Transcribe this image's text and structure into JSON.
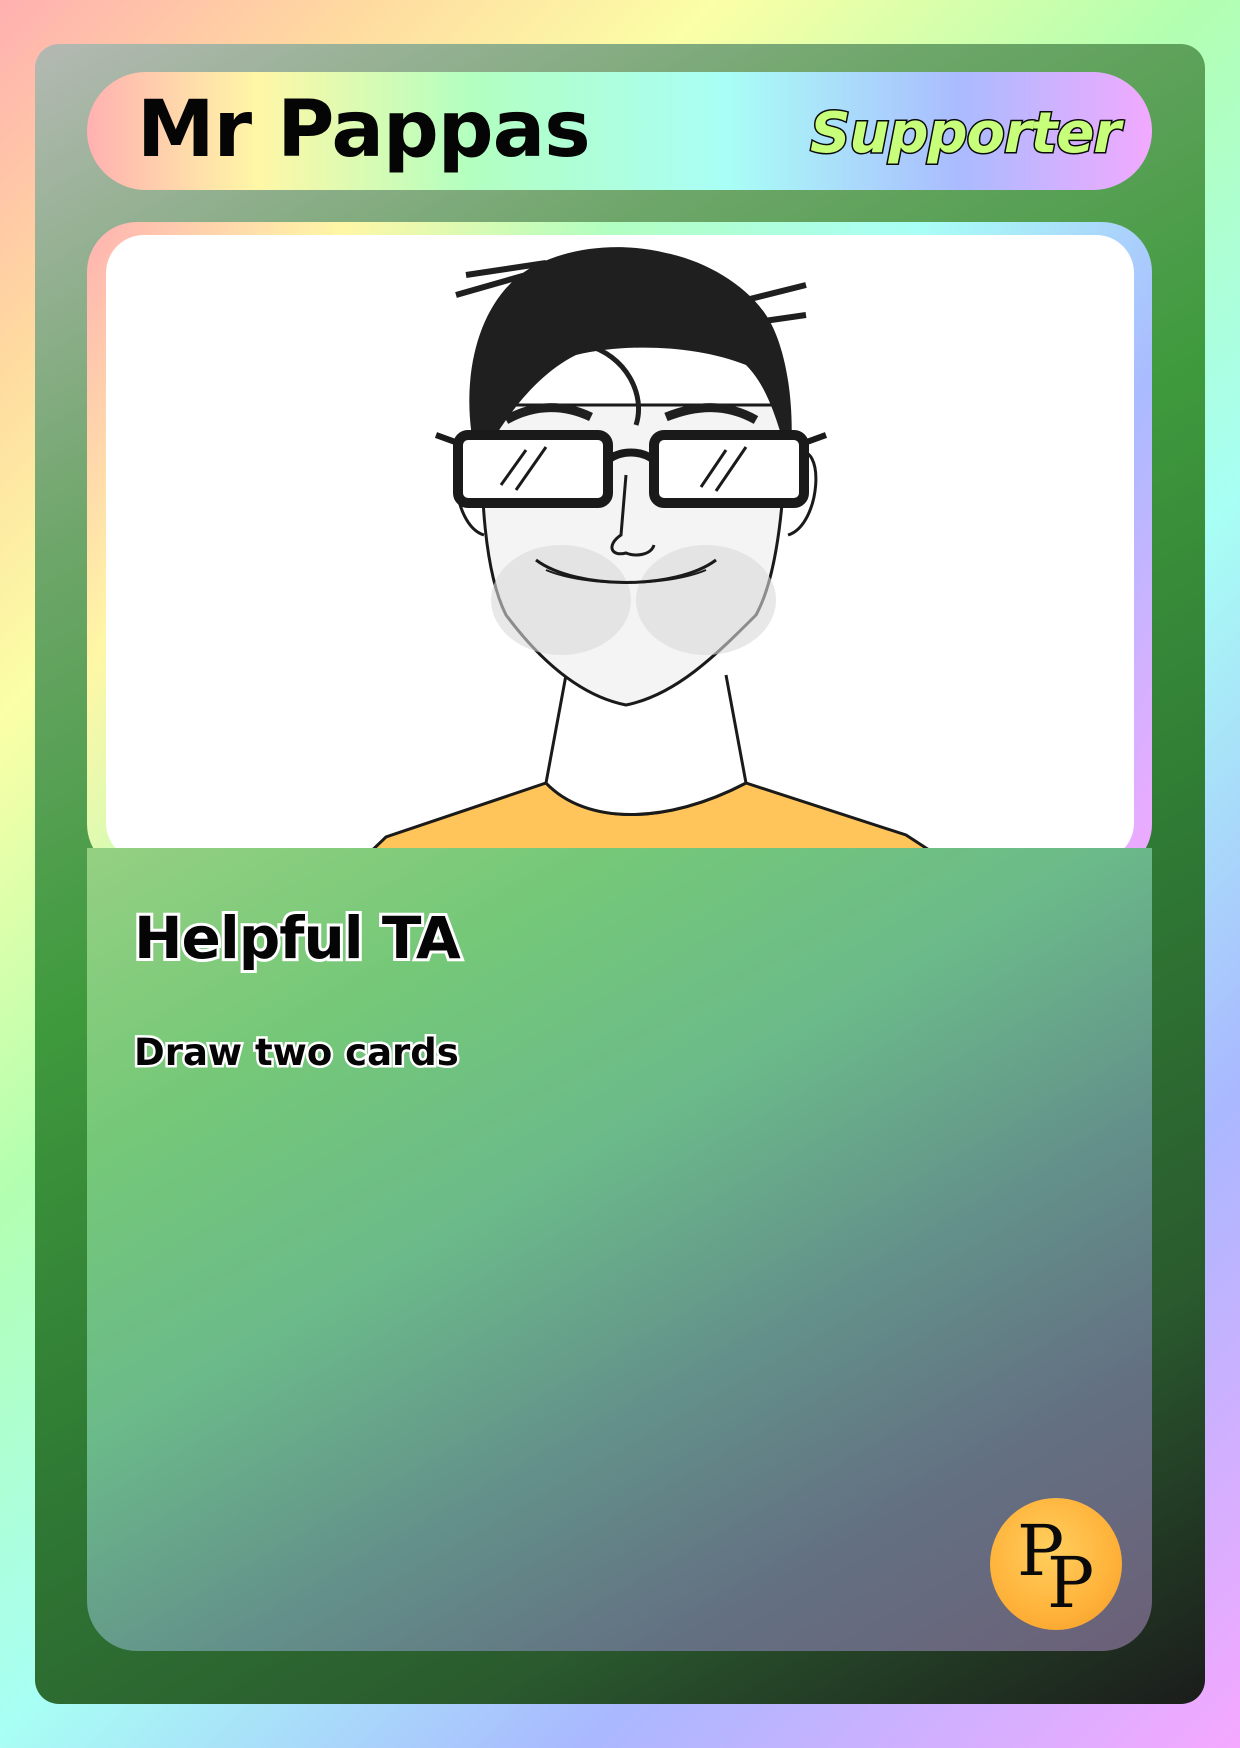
{
  "card": {
    "name": "Mr Pappas",
    "role": "Supporter",
    "ability_title": "Helpful TA",
    "ability_text": "Draw two cards",
    "logo_text": "PP",
    "logo_letter_1": "P",
    "logo_letter_2": "P"
  },
  "colors": {
    "name_text": "#050505",
    "role_text": "#c7ff7a",
    "shirt": "#ffc45a",
    "logo": "#ffb23a",
    "card_frame": "#3f9a3d"
  },
  "portrait": {
    "subject": "sketch-of-man-with-glasses-and-orange-shirt"
  }
}
